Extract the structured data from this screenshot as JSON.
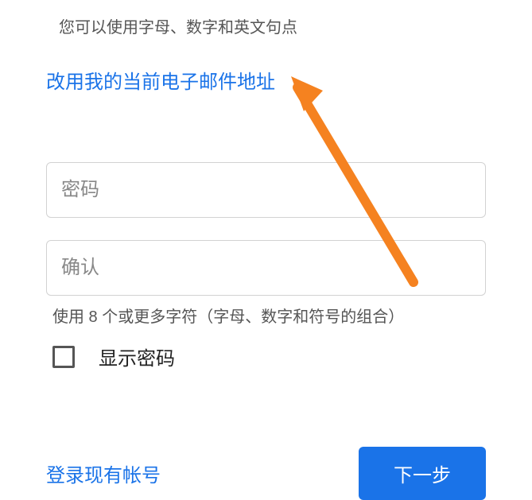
{
  "hint": "您可以使用字母、数字和英文句点",
  "useCurrentEmailLink": "改用我的当前电子邮件地址",
  "passwordField": {
    "placeholder": "密码"
  },
  "confirmField": {
    "placeholder": "确认"
  },
  "passwordHelper": "使用 8 个或更多字符（字母、数字和符号的组合）",
  "showPasswordLabel": "显示密码",
  "signinLink": "登录现有帐号",
  "nextButton": "下一步",
  "colors": {
    "primary": "#1a73e8",
    "arrow": "#f58220"
  }
}
